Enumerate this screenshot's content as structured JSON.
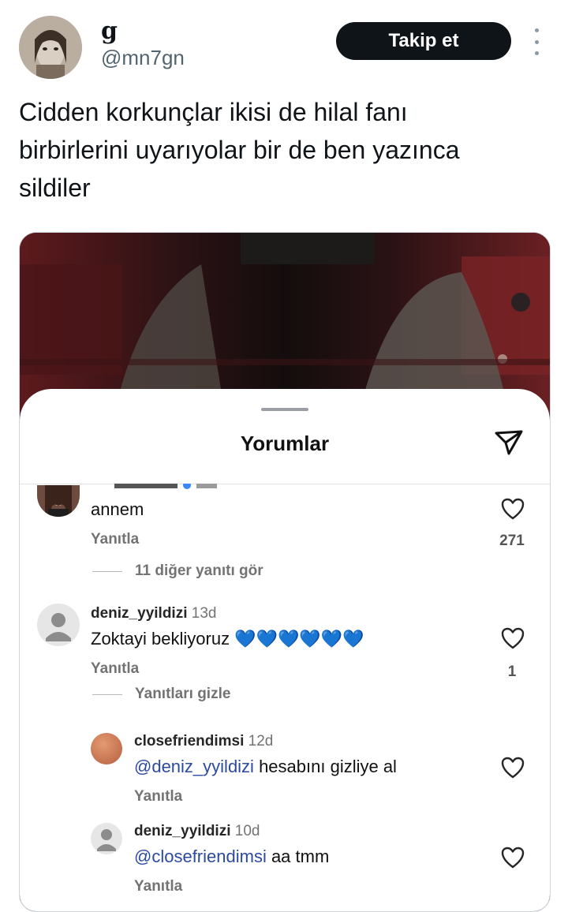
{
  "tweet": {
    "display_name": "g",
    "handle": "@mn7gn",
    "follow_label": "Takip et",
    "text": "Cidden korkunçlar  ikisi de hilal fanı\nbirbirlerini uyarıyolar bir de ben yazınca\nsildiler"
  },
  "sheet": {
    "title": "Yorumlar",
    "comments": [
      {
        "text": "annem",
        "reply_label": "Yanıtla",
        "likes": "271",
        "toggle_label": "11 diğer yanıtı gör"
      },
      {
        "username": "deniz_yyildizi",
        "time": "13d",
        "text": "Zoktayi bekliyoruz 💙💙💙💙💙💙",
        "reply_label": "Yanıtla",
        "likes": "1",
        "toggle_label": "Yanıtları gizle"
      },
      {
        "username": "closefriendimsi",
        "time": "12d",
        "mention": "@deniz_yyildizi",
        "text": " hesabını gizliye al",
        "reply_label": "Yanıtla"
      },
      {
        "username": "deniz_yyildizi",
        "time": "10d",
        "mention": "@closefriendimsi",
        "text": " aa tmm",
        "reply_label": "Yanıtla"
      }
    ]
  },
  "colors": {
    "follow_button_bg": "#0f1419",
    "mention": "#2b4aa0",
    "secondary_text": "#737373",
    "heart_emoji": "#1a73e8"
  },
  "icons": {
    "more": "more-vertical-icon",
    "send": "send-paper-plane-icon",
    "like": "heart-outline-icon"
  }
}
